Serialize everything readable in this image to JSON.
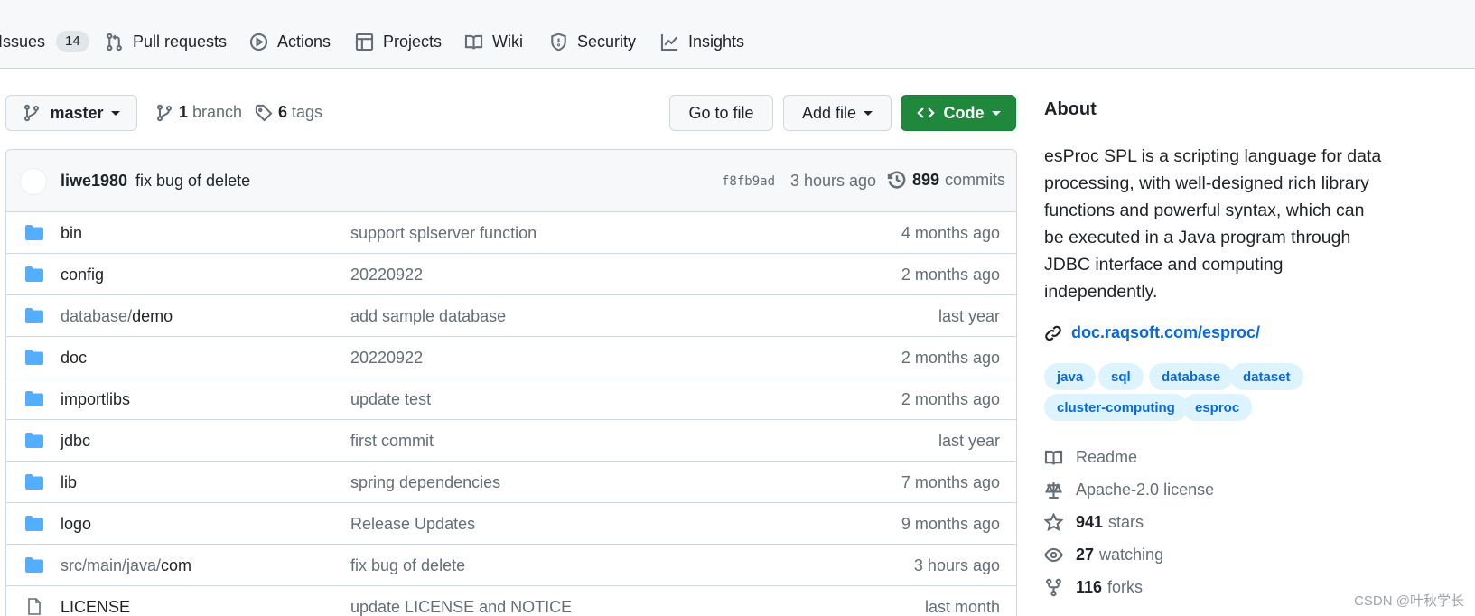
{
  "nav": {
    "issues": {
      "label": "Issues",
      "count": "14"
    },
    "pull_requests": "Pull requests",
    "actions": "Actions",
    "projects": "Projects",
    "wiki": "Wiki",
    "security": "Security",
    "insights": "Insights"
  },
  "toolbar": {
    "branch_selector": "master",
    "branch_count": "1",
    "branch_label": "branch",
    "tag_count": "6",
    "tag_label": "tags",
    "go_to_file": "Go to file",
    "add_file": "Add file",
    "code": "Code"
  },
  "latest_commit": {
    "author": "liwe1980",
    "message": "fix bug of delete",
    "sha": "f8fb9ad",
    "time": "3 hours ago",
    "commit_count": "899",
    "commit_label": "commits"
  },
  "files": [
    {
      "type": "dir",
      "name_prefix": "",
      "name": "bin",
      "message": "support splserver function",
      "time": "4 months ago"
    },
    {
      "type": "dir",
      "name_prefix": "",
      "name": "config",
      "message": "20220922",
      "time": "2 months ago"
    },
    {
      "type": "dir",
      "name_prefix": "database/",
      "name": "demo",
      "message": "add sample database",
      "time": "last year"
    },
    {
      "type": "dir",
      "name_prefix": "",
      "name": "doc",
      "message": "20220922",
      "time": "2 months ago"
    },
    {
      "type": "dir",
      "name_prefix": "",
      "name": "importlibs",
      "message": "update test",
      "time": "2 months ago"
    },
    {
      "type": "dir",
      "name_prefix": "",
      "name": "jdbc",
      "message": "first commit",
      "time": "last year"
    },
    {
      "type": "dir",
      "name_prefix": "",
      "name": "lib",
      "message": "spring dependencies",
      "time": "7 months ago"
    },
    {
      "type": "dir",
      "name_prefix": "",
      "name": "logo",
      "message": "Release Updates",
      "time": "9 months ago"
    },
    {
      "type": "dir",
      "name_prefix": "src/main/java/",
      "name": "com",
      "message": "fix bug of delete",
      "time": "3 hours ago"
    },
    {
      "type": "file",
      "name_prefix": "",
      "name": "LICENSE",
      "message": "update LICENSE and NOTICE",
      "time": "last month"
    }
  ],
  "about": {
    "title": "About",
    "description": "esProc SPL is a scripting language for data processing, with well-designed rich library functions and powerful syntax, which can be executed in a Java program through JDBC interface and computing independently.",
    "link": "doc.raqsoft.com/esproc/",
    "topics": [
      "java",
      "sql",
      "database",
      "dataset",
      "cluster-computing",
      "esproc"
    ],
    "readme": "Readme",
    "license": "Apache-2.0 license",
    "stars_count": "941",
    "stars_label": "stars",
    "watching_count": "27",
    "watching_label": "watching",
    "forks_count": "116",
    "forks_label": "forks"
  },
  "watermark": "CSDN @叶秋学长",
  "colors": {
    "accent_link": "#0969da",
    "code_button": "#1f883d",
    "folder_icon": "#54aeff",
    "topic_bg": "#ddf4ff"
  }
}
